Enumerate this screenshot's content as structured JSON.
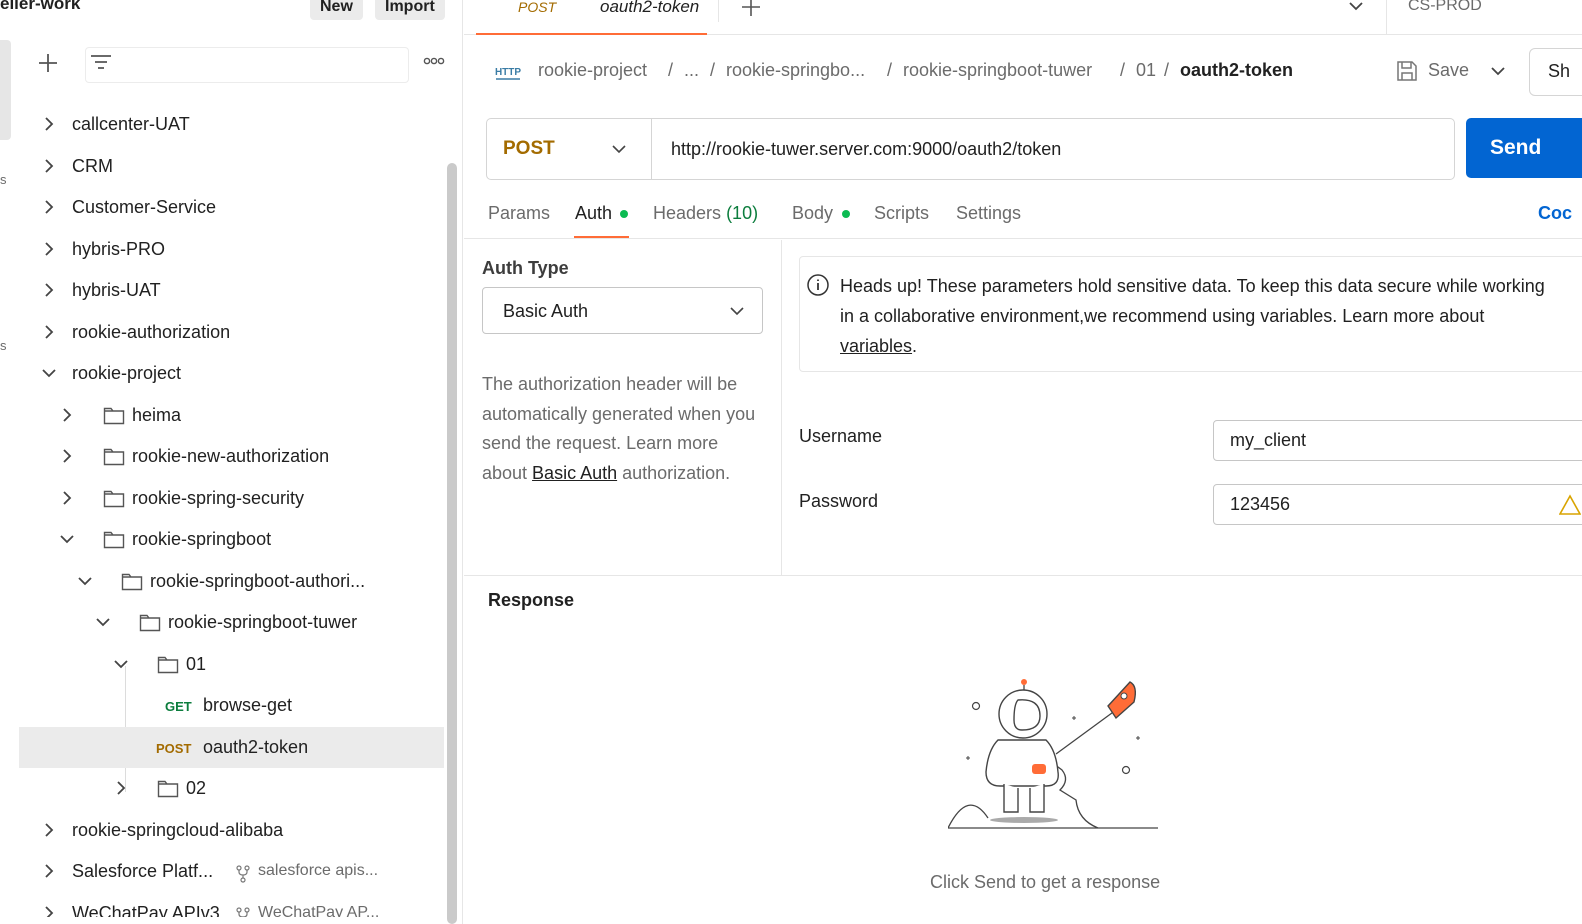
{
  "workspace": {
    "name": "eller-work",
    "new_label": "New",
    "import_label": "Import"
  },
  "rail": {
    "labels": [
      "s",
      "s"
    ]
  },
  "sidebar": {
    "tree": [
      {
        "label": "callcenter-UAT"
      },
      {
        "label": "CRM"
      },
      {
        "label": "Customer-Service"
      },
      {
        "label": "hybris-PRO"
      },
      {
        "label": "hybris-UAT"
      },
      {
        "label": "rookie-authorization"
      },
      {
        "label": "rookie-project"
      },
      {
        "label": "heima"
      },
      {
        "label": "rookie-new-authorization"
      },
      {
        "label": "rookie-spring-security"
      },
      {
        "label": "rookie-springboot"
      },
      {
        "label": "rookie-springboot-authori..."
      },
      {
        "label": "rookie-springboot-tuwer"
      },
      {
        "label": "01"
      },
      {
        "label": "browse-get",
        "method": "GET"
      },
      {
        "label": "oauth2-token",
        "method": "POST"
      },
      {
        "label": "02"
      },
      {
        "label": "rookie-springcloud-alibaba"
      },
      {
        "label": "Salesforce Platf...",
        "fork": "salesforce apis..."
      },
      {
        "label": "WeChatPay APIv3",
        "fork": "WeChatPay AP..."
      }
    ]
  },
  "tabbar": {
    "active_method": "POST",
    "active_title": "oauth2-token",
    "environment": "CS-PROD"
  },
  "breadcrumb": {
    "items": [
      "rookie-project",
      "...",
      "rookie-springbo...",
      "rookie-springboot-tuwer",
      "01"
    ],
    "separator": "/",
    "current": "oauth2-token",
    "http_badge": "HTTP",
    "save_label": "Save",
    "share_label": "Sh"
  },
  "request": {
    "method": "POST",
    "url": "http://rookie-tuwer.server.com:9000/oauth2/token",
    "send_label": "Send"
  },
  "req_tabs": {
    "params": "Params",
    "auth": "Auth",
    "headers": "Headers",
    "headers_count": "(10)",
    "body": "Body",
    "scripts": "Scripts",
    "settings": "Settings",
    "code": "Coc"
  },
  "auth": {
    "type_label": "Auth Type",
    "type_value": "Basic Auth",
    "desc_pre": "The authorization header will be automatically generated when you send the request. Learn more about ",
    "desc_link": "Basic Auth",
    "desc_post": " authorization.",
    "info_pre": "Heads up! These parameters hold sensitive data. To keep this data secure while working in a collaborative environment,we recommend using variables. Learn more about ",
    "info_link": "variables",
    "info_post": ".",
    "username_label": "Username",
    "username_value": "my_client",
    "password_label": "Password",
    "password_value": "123456"
  },
  "response": {
    "title": "Response",
    "empty_message": "Click Send to get a response"
  },
  "colors": {
    "accent": "#ff6c37",
    "send": "#0265d2",
    "post": "#a36b00",
    "get": "#0c7d3d",
    "dot": "#0cbb52"
  }
}
